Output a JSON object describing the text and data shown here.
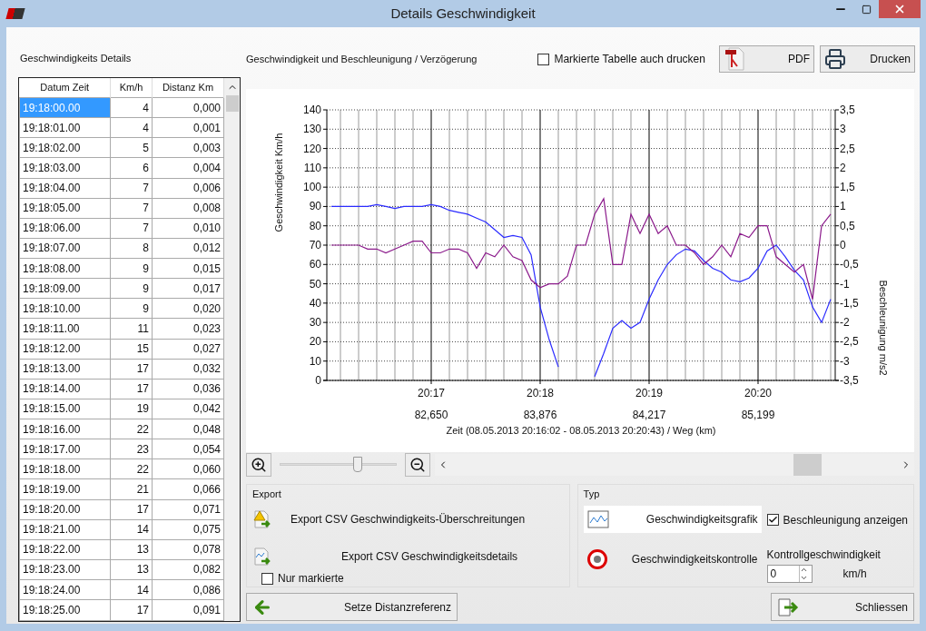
{
  "window": {
    "title": "Details Geschwindigkeit"
  },
  "left_panel": {
    "heading": "Geschwindigkeits Details",
    "table": {
      "columns": [
        "Datum Zeit",
        "Km/h",
        "Distanz Km"
      ],
      "rows": [
        {
          "cells": [
            "19:18:00.00",
            "4",
            "0,000"
          ],
          "selected": true
        },
        {
          "cells": [
            "19:18:01.00",
            "4",
            "0,001"
          ],
          "selected": false
        },
        {
          "cells": [
            "19:18:02.00",
            "5",
            "0,003"
          ],
          "selected": false
        },
        {
          "cells": [
            "19:18:03.00",
            "6",
            "0,004"
          ],
          "selected": false
        },
        {
          "cells": [
            "19:18:04.00",
            "7",
            "0,006"
          ],
          "selected": false
        },
        {
          "cells": [
            "19:18:05.00",
            "7",
            "0,008"
          ],
          "selected": false
        },
        {
          "cells": [
            "19:18:06.00",
            "7",
            "0,010"
          ],
          "selected": false
        },
        {
          "cells": [
            "19:18:07.00",
            "8",
            "0,012"
          ],
          "selected": false
        },
        {
          "cells": [
            "19:18:08.00",
            "9",
            "0,015"
          ],
          "selected": false
        },
        {
          "cells": [
            "19:18:09.00",
            "9",
            "0,017"
          ],
          "selected": false
        },
        {
          "cells": [
            "19:18:10.00",
            "9",
            "0,020"
          ],
          "selected": false
        },
        {
          "cells": [
            "19:18:11.00",
            "11",
            "0,023"
          ],
          "selected": false
        },
        {
          "cells": [
            "19:18:12.00",
            "15",
            "0,027"
          ],
          "selected": false
        },
        {
          "cells": [
            "19:18:13.00",
            "17",
            "0,032"
          ],
          "selected": false
        },
        {
          "cells": [
            "19:18:14.00",
            "17",
            "0,036"
          ],
          "selected": false
        },
        {
          "cells": [
            "19:18:15.00",
            "19",
            "0,042"
          ],
          "selected": false
        },
        {
          "cells": [
            "19:18:16.00",
            "22",
            "0,048"
          ],
          "selected": false
        },
        {
          "cells": [
            "19:18:17.00",
            "23",
            "0,054"
          ],
          "selected": false
        },
        {
          "cells": [
            "19:18:18.00",
            "22",
            "0,060"
          ],
          "selected": false
        },
        {
          "cells": [
            "19:18:19.00",
            "21",
            "0,066"
          ],
          "selected": false
        },
        {
          "cells": [
            "19:18:20.00",
            "17",
            "0,071"
          ],
          "selected": false
        },
        {
          "cells": [
            "19:18:21.00",
            "14",
            "0,075"
          ],
          "selected": false
        },
        {
          "cells": [
            "19:18:22.00",
            "13",
            "0,078"
          ],
          "selected": false
        },
        {
          "cells": [
            "19:18:23.00",
            "13",
            "0,082"
          ],
          "selected": false
        },
        {
          "cells": [
            "19:18:24.00",
            "14",
            "0,086"
          ],
          "selected": false
        },
        {
          "cells": [
            "19:18:25.00",
            "17",
            "0,091"
          ],
          "selected": false
        }
      ]
    }
  },
  "chart_section": {
    "heading": "Geschwindigkeit und Beschleunigung / Verzögerung",
    "print_checkbox": {
      "label": "Markierte Tabelle auch drucken",
      "checked": false
    },
    "buttons": [
      {
        "label": "PDF",
        "kind": "pdf"
      },
      {
        "label": "Drucken",
        "kind": "print"
      }
    ]
  },
  "chart": {
    "chart_data": {
      "type": "line",
      "grid": true,
      "xlabel": "Zeit (08.05.2013 20:16:02 - 08.05.2013 20:20:43) /  Weg (km)",
      "ylabel": "Geschwindigkeit Km/h",
      "y2label": "Beschleunigung m/s2",
      "ylim": [
        0,
        140
      ],
      "y2lim": [
        -3.5,
        3.5
      ],
      "categories": [
        null,
        null,
        null,
        null,
        null,
        null,
        null,
        null,
        null,
        null,
        null,
        "20:17",
        null,
        null,
        null,
        null,
        null,
        null,
        null,
        null,
        null,
        null,
        null,
        "20:18",
        null,
        null,
        null,
        null,
        null,
        null,
        null,
        null,
        null,
        null,
        null,
        "20:19",
        null,
        null,
        null,
        null,
        null,
        null,
        null,
        null,
        null,
        null,
        null,
        "20:20",
        null,
        null,
        null,
        null,
        null,
        null,
        null,
        null
      ],
      "annotations": [
        "82,650",
        "83,876",
        "84,217",
        "85,199"
      ],
      "yticks": [
        0,
        10,
        20,
        30,
        40,
        50,
        60,
        70,
        80,
        90,
        100,
        110,
        120,
        130,
        140
      ],
      "y2ticks": [
        {
          "value": -3.5,
          "label": "-3,5"
        },
        {
          "value": -3,
          "label": "-3"
        },
        {
          "value": -2.5,
          "label": "-2,5"
        },
        {
          "value": -2,
          "label": "-2"
        },
        {
          "value": -1.5,
          "label": "-1,5"
        },
        {
          "value": -1,
          "label": "-1"
        },
        {
          "value": -0.5,
          "label": "-0,5"
        },
        {
          "value": 0,
          "label": "0"
        },
        {
          "value": 0.5,
          "label": "0,5"
        },
        {
          "value": 1,
          "label": "1"
        },
        {
          "value": 1.5,
          "label": "1,5"
        },
        {
          "value": 2,
          "label": "2"
        },
        {
          "value": 2.5,
          "label": "2,5"
        },
        {
          "value": 3,
          "label": "3"
        },
        {
          "value": 3.5,
          "label": "3,5"
        }
      ],
      "series": [
        {
          "color": "#2b2bff",
          "values": [
            90,
            90,
            90,
            90,
            90,
            91,
            90,
            89,
            90,
            90,
            90,
            91,
            90,
            88,
            87,
            86,
            84,
            82,
            78,
            74,
            75,
            74,
            65,
            38,
            21,
            7,
            null,
            null,
            null,
            2,
            14,
            27,
            31,
            27,
            30,
            42,
            52,
            60,
            65,
            68,
            67,
            62,
            58,
            56,
            52,
            51,
            53,
            58,
            67,
            70,
            64,
            57,
            52,
            38,
            30,
            42
          ]
        },
        {
          "color": "#8b1a8b",
          "axis": "y2",
          "values": [
            0,
            0,
            0,
            0,
            -0.1,
            -0.1,
            -0.2,
            -0.1,
            0,
            0.1,
            0.1,
            -0.2,
            -0.2,
            -0.1,
            -0.1,
            -0.2,
            -0.6,
            -0.2,
            -0.3,
            0,
            -0.3,
            -0.4,
            -0.9,
            -1.1,
            -1.0,
            -1.0,
            -0.8,
            0,
            0,
            0.8,
            1.2,
            -0.5,
            -0.5,
            0.8,
            0.3,
            0.8,
            0.3,
            0.5,
            0,
            0,
            -0.2,
            -0.5,
            -0.3,
            0,
            -0.3,
            0.3,
            0.2,
            0.5,
            0.5,
            -0.3,
            -0.5,
            -0.7,
            -0.5,
            -1.4,
            0.5,
            0.8
          ]
        }
      ]
    }
  },
  "zoom": {
    "level": 0.65
  },
  "export_group": {
    "title": "Export",
    "buttons": [
      {
        "label": "Export CSV Geschwindigkeits-Überschreitungen",
        "kind": "warning"
      },
      {
        "label": "Export CSV Geschwindigkeitsdetails",
        "kind": "chart"
      }
    ],
    "checkbox": {
      "label": "Nur markierte",
      "checked": false
    }
  },
  "type_group": {
    "title": "Typ",
    "options": [
      {
        "label": "Geschwindigkeitsgrafik",
        "kind": "graph",
        "selected": true
      },
      {
        "label": "Geschwindigkeitskontrolle",
        "kind": "speed",
        "selected": false
      }
    ],
    "accel_checkbox": {
      "label": "Beschleunigung anzeigen",
      "checked": true
    },
    "control_speed": {
      "label": "Kontrollgeschwindigkeit",
      "value": "0",
      "unit": "km/h"
    }
  },
  "footer_buttons": [
    {
      "label": "Setze Distanzreferenz",
      "kind": "back"
    },
    {
      "label": "Schliessen",
      "kind": "exit"
    }
  ]
}
